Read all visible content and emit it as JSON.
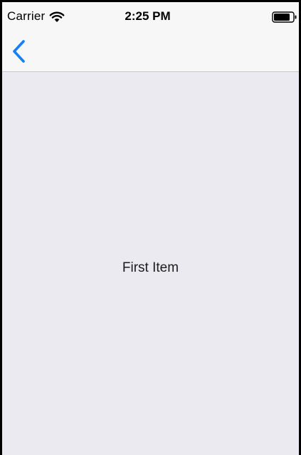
{
  "status_bar": {
    "carrier": "Carrier",
    "time": "2:25 PM",
    "wifi_icon": "wifi-icon",
    "battery_icon": "battery-icon"
  },
  "nav_bar": {
    "back_icon": "chevron-left-icon",
    "accent_color": "#147efb"
  },
  "content": {
    "label": "First Item",
    "background_color": "#ebeaf0"
  }
}
